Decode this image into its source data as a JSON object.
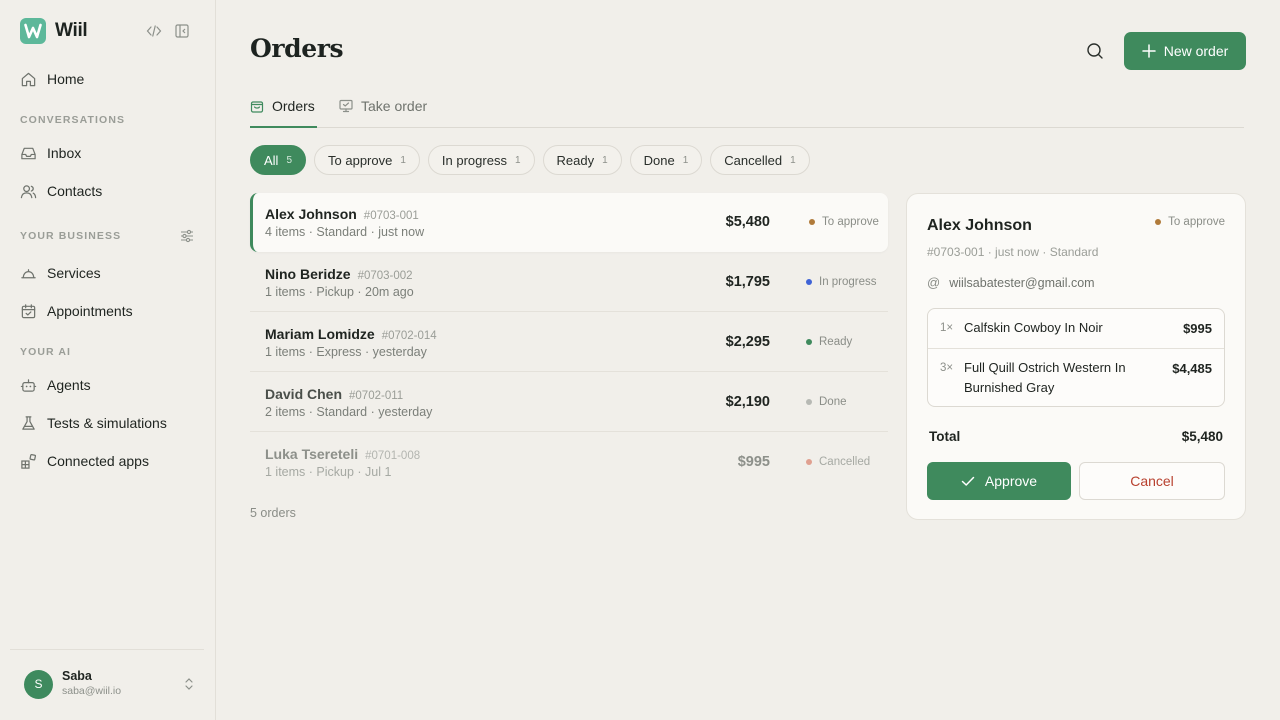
{
  "app": {
    "name": "Wiil"
  },
  "sidebar": {
    "home": "Home",
    "sections": {
      "conversations": "CONVERSATIONS",
      "business": "YOUR BUSINESS",
      "ai": "YOUR AI"
    },
    "items": {
      "inbox": "Inbox",
      "contacts": "Contacts",
      "services": "Services",
      "appointments": "Appointments",
      "agents": "Agents",
      "tests": "Tests & simulations",
      "connected_apps": "Connected apps"
    },
    "user": {
      "initial": "S",
      "name": "Saba",
      "email": "saba@wiil.io"
    }
  },
  "header": {
    "title": "Orders",
    "new_order_label": "New order"
  },
  "tabs": [
    {
      "label": "Orders",
      "icon": "bag-icon"
    },
    {
      "label": "Take order",
      "icon": "monitor-icon"
    }
  ],
  "filters": [
    {
      "label": "All",
      "count": "5"
    },
    {
      "label": "To approve",
      "count": "1"
    },
    {
      "label": "In progress",
      "count": "1"
    },
    {
      "label": "Ready",
      "count": "1"
    },
    {
      "label": "Done",
      "count": "1"
    },
    {
      "label": "Cancelled",
      "count": "1"
    }
  ],
  "status_colors": {
    "to_approve": "#b07a3a",
    "in_progress": "#3f63d6",
    "ready": "#3f8a5d",
    "done": "#b7b9b4",
    "cancelled": "#e0a090"
  },
  "orders": [
    {
      "name": "Alex Johnson",
      "id": "#0703-001",
      "meta": "4 items · Standard · just now",
      "price": "$5,480",
      "status": "To approve"
    },
    {
      "name": "Nino Beridze",
      "id": "#0703-002",
      "meta": "1 items · Pickup · 20m ago",
      "price": "$1,795",
      "status": "In progress"
    },
    {
      "name": "Mariam Lomidze",
      "id": "#0702-014",
      "meta": "1 items · Express · yesterday",
      "price": "$2,295",
      "status": "Ready"
    },
    {
      "name": "David Chen",
      "id": "#0702-011",
      "meta": "2 items · Standard · yesterday",
      "price": "$2,190",
      "status": "Done"
    },
    {
      "name": "Luka Tsereteli",
      "id": "#0701-008",
      "meta": "1 items · Pickup · Jul 1",
      "price": "$995",
      "status": "Cancelled"
    }
  ],
  "orders_count": "5 orders",
  "detail": {
    "name": "Alex Johnson",
    "status": "To approve",
    "meta": "#0703-001 · just now · Standard",
    "email": "wiilsabatester@gmail.com",
    "items": [
      {
        "qty": "1×",
        "name": "Calfskin Cowboy In Noir",
        "price": "$995"
      },
      {
        "qty": "3×",
        "name": "Full Quill Ostrich Western In Burnished Gray",
        "price": "$4,485"
      }
    ],
    "total_label": "Total",
    "total_value": "$5,480",
    "approve_label": "Approve",
    "cancel_label": "Cancel"
  }
}
